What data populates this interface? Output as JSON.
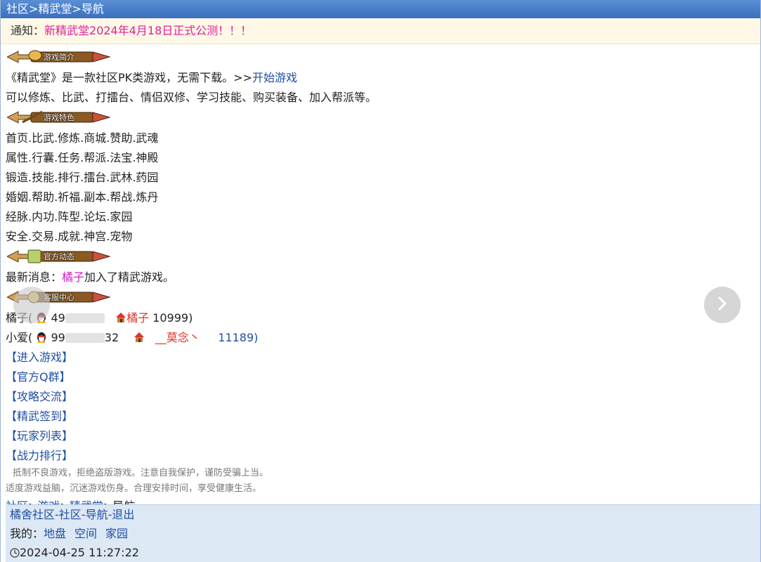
{
  "topbar": {
    "title": "社区>精武堂>导航"
  },
  "notice": {
    "label": "通知：",
    "message": "新精武堂2024年4月18日正式公测",
    "suffix": "！！！"
  },
  "badges": {
    "intro": "游戏简介",
    "features": "游戏特色",
    "news": "官方动态",
    "service": "客服中心"
  },
  "intro": {
    "line1_prefix": "《精武堂》是一款社区PK类游戏，无需下载。>>",
    "start_link": "开始游戏",
    "line2": "可以修炼、比武、打擂台、情侣双修、学习技能、购买装备、加入帮派等。"
  },
  "features": [
    "首页.比武.修炼.商城.赞助.武魂",
    "属性.行囊.任务.帮派.法宝.神殿",
    "锻造.技能.排行.擂台.武林.药园",
    "婚姻.帮助.祈福.副本.帮战.炼丹",
    "经脉.内功.阵型.论坛.家园",
    "安全.交易.成就.神宫.宠物"
  ],
  "news": {
    "prefix": "最新消息：",
    "user": "橘子",
    "suffix": "加入了精武游戏。"
  },
  "service": {
    "row1": {
      "name": "橘子(",
      "qq_visible": "49",
      "player": "橘子",
      "player_id": "10999)"
    },
    "row2": {
      "name": "小爱(",
      "qq_visible": "99",
      "qq_tail": "32",
      "player": "__莫念丶",
      "player_id": "11189)"
    }
  },
  "menu_links": [
    "【进入游戏】",
    "【官方Q群】",
    "【攻略交流】",
    "【精武签到】",
    "【玩家列表】",
    "【战力排行】"
  ],
  "disclaimer": {
    "line1": "抵制不良游戏，拒绝盗版游戏。注意自我保护，谨防受骗上当。",
    "line2": "适度游戏益脑，沉迷游戏伤身。合理安排时间，享受健康生活。"
  },
  "breadcrumb": {
    "item1": "社区",
    "sep1": ">",
    "item2": "游戏",
    "sep2": ">",
    "item3": "精武堂",
    "tail": ">导航"
  },
  "footer": {
    "links": {
      "home": "橘舍社区",
      "community": "社区",
      "nav": "导航",
      "logout": "退出",
      "dash": "-"
    },
    "mine_label": "我的：",
    "mine": [
      "地盘",
      "空间",
      "家园"
    ],
    "time": "2024-04-25 11:27:22"
  },
  "colors": {
    "accent": "#1f4fa3",
    "pink": "#d321c9",
    "red": "#e0342a",
    "topbar": "#3a6fbd",
    "footer_bg": "#dde8f5"
  }
}
